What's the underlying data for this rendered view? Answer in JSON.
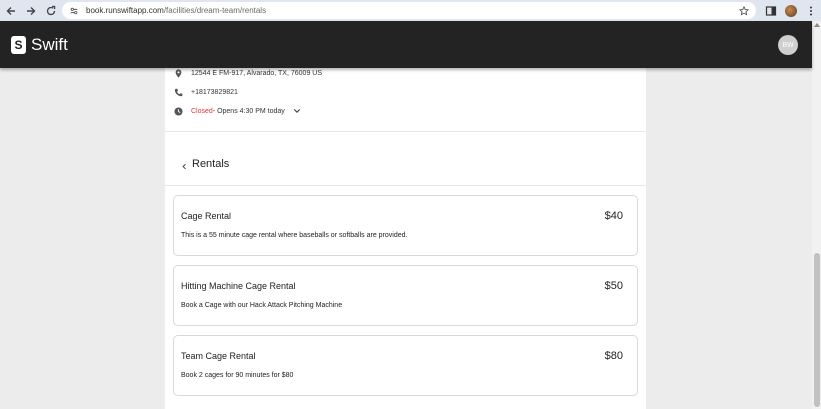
{
  "browser": {
    "url_host": "book.runswiftapp.com",
    "url_path": "/facilities/dream-team/rentals"
  },
  "header": {
    "logo_text": "Swift",
    "logo_mark": "S",
    "avatar_initials": "BW"
  },
  "facility": {
    "address": "12544 E FM-917, Alvarado, TX, 76009 US",
    "phone": "+18173829821",
    "status": "Closed",
    "hours_detail": " - Opens 4:30 PM today"
  },
  "rentals": {
    "title": "Rentals",
    "items": [
      {
        "name": "Cage Rental",
        "price": "$40",
        "description": "This is a 55 minute cage rental where baseballs or softballs are provided."
      },
      {
        "name": "Hitting Machine Cage Rental",
        "price": "$50",
        "description": "Book a Cage with our Hack Attack Pitching Machine"
      },
      {
        "name": "Team Cage Rental",
        "price": "$80",
        "description": "Book 2 cages for 90 minutes for $80"
      }
    ]
  },
  "icons": {
    "back": "arrow-left-icon",
    "forward": "arrow-right-icon",
    "reload": "reload-icon",
    "site_settings": "tune-icon",
    "bookmark": "star-icon",
    "sidepanel": "sidepanel-icon",
    "profile": "profile-icon",
    "menu": "kebab-menu-icon",
    "location": "location-pin-icon",
    "phone": "phone-icon",
    "clock": "clock-icon",
    "expand": "chevron-down-icon",
    "rentals_back": "chevron-left-icon"
  },
  "colors": {
    "header_bg": "#232323",
    "closed": "#e53935",
    "chrome_bg": "#dfe6f0"
  }
}
